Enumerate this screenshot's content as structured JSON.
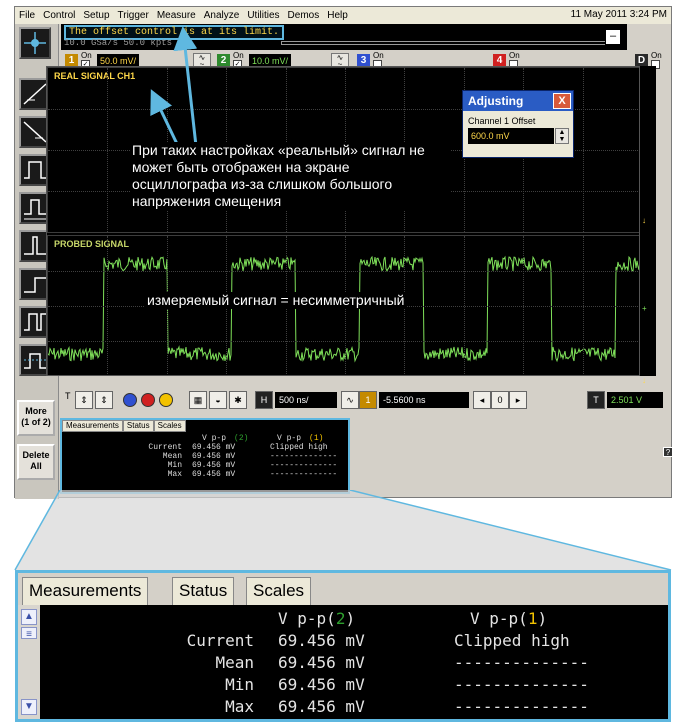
{
  "menubar": {
    "items": [
      "File",
      "Control",
      "Setup",
      "Trigger",
      "Measure",
      "Analyze",
      "Utilities",
      "Demos",
      "Help"
    ],
    "datetime": "11 May 2011  3:24 PM"
  },
  "status": {
    "message": "The offset control is at its limit.",
    "acquisition": "10.0 GSa/s   50.0 kpts"
  },
  "channels": [
    {
      "num": "1",
      "on_label": "On",
      "scale": "50.0 mV/",
      "color": "#f2c200",
      "checked": true
    },
    {
      "num": "2",
      "on_label": "On",
      "scale": "10.0 mV/",
      "color": "#2ea02e",
      "checked": true
    },
    {
      "num": "3",
      "on_label": "On",
      "scale": "",
      "color": "#3050d0",
      "checked": false
    },
    {
      "num": "4",
      "on_label": "On",
      "scale": "",
      "color": "#d02020",
      "checked": false
    },
    {
      "num": "D",
      "on_label": "On",
      "scale": "",
      "color": "#2a2a2a",
      "checked": false
    }
  ],
  "screen": {
    "pane1_label": "REAL SIGNAL CH1",
    "pane2_label": "PROBED SIGNAL",
    "signal_color": "#7fe05a",
    "label_color": "#ffd84a"
  },
  "adjust_dialog": {
    "title": "Adjusting",
    "close": "X",
    "label": "Channel 1 Offset",
    "value": "600.0 mV"
  },
  "annotations": {
    "main": "При таких настройках «реальный» сигнал не может быть отображен на экране осциллографа из-за слишком большого напряжения смещения",
    "signal": "измеряемый сигнал = несимметричный"
  },
  "side_buttons": {
    "more": "More\n(1 of 2)",
    "delete": "Delete\nAll"
  },
  "controls": {
    "timebase": "500 ns/",
    "delay": "-5.5600 ns",
    "trigger_level": "2.501 V",
    "trigger_channel": "1"
  },
  "measurements": {
    "tabs": [
      "Measurements",
      "Status",
      "Scales"
    ],
    "header": {
      "col1": "V p-p",
      "col1_ch": "2",
      "col2": "V p-p",
      "col2_ch": "1"
    },
    "rows": [
      {
        "label": "Current",
        "v1": "69.456 mV",
        "v2": "Clipped high"
      },
      {
        "label": "Mean",
        "v1": "69.456 mV",
        "v2": "--------------"
      },
      {
        "label": "Min",
        "v1": "69.456 mV",
        "v2": "--------------"
      },
      {
        "label": "Max",
        "v1": "69.456 mV",
        "v2": "--------------"
      }
    ],
    "ch1_color": "#f2c200",
    "ch2_color": "#2ea02e"
  },
  "accent_color": "#5fb8e0"
}
